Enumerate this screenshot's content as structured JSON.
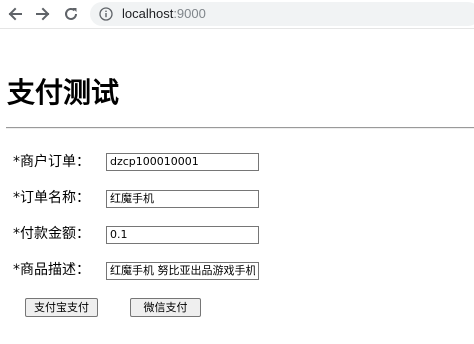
{
  "browser": {
    "back_icon": "arrow-left-icon",
    "forward_icon": "arrow-right-icon",
    "reload_icon": "reload-icon",
    "info_icon": "info-circle-icon",
    "url_host": "localhost",
    "url_port": ":9000"
  },
  "page": {
    "title": "支付测试"
  },
  "form": {
    "order_no": {
      "label": "*商户订单：",
      "value": "dzcp100010001"
    },
    "order_name": {
      "label": "*订单名称：",
      "value": "红魔手机"
    },
    "amount": {
      "label": "*付款金额：",
      "value": "0.1"
    },
    "description": {
      "label": "*商品描述：",
      "value": "红魔手机 努比亚出品游戏手机"
    }
  },
  "buttons": {
    "alipay": "支付宝支付",
    "wechat": "微信支付"
  },
  "colors": {
    "omnibox_bg": "#f1f3f4",
    "button_bg": "#efefef",
    "divider": "#9a9a9a"
  }
}
